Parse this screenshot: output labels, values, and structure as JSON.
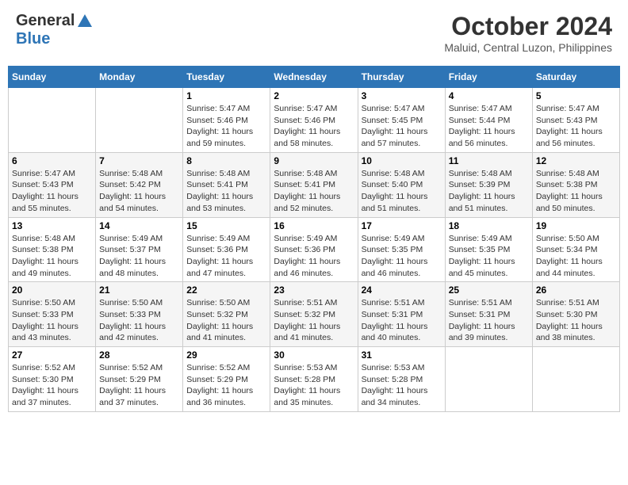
{
  "header": {
    "logo_line1": "General",
    "logo_line2": "Blue",
    "month": "October 2024",
    "location": "Maluid, Central Luzon, Philippines"
  },
  "weekdays": [
    "Sunday",
    "Monday",
    "Tuesday",
    "Wednesday",
    "Thursday",
    "Friday",
    "Saturday"
  ],
  "weeks": [
    [
      {
        "day": "",
        "sunrise": "",
        "sunset": "",
        "daylight": ""
      },
      {
        "day": "",
        "sunrise": "",
        "sunset": "",
        "daylight": ""
      },
      {
        "day": "1",
        "sunrise": "Sunrise: 5:47 AM",
        "sunset": "Sunset: 5:46 PM",
        "daylight": "Daylight: 11 hours and 59 minutes."
      },
      {
        "day": "2",
        "sunrise": "Sunrise: 5:47 AM",
        "sunset": "Sunset: 5:46 PM",
        "daylight": "Daylight: 11 hours and 58 minutes."
      },
      {
        "day": "3",
        "sunrise": "Sunrise: 5:47 AM",
        "sunset": "Sunset: 5:45 PM",
        "daylight": "Daylight: 11 hours and 57 minutes."
      },
      {
        "day": "4",
        "sunrise": "Sunrise: 5:47 AM",
        "sunset": "Sunset: 5:44 PM",
        "daylight": "Daylight: 11 hours and 56 minutes."
      },
      {
        "day": "5",
        "sunrise": "Sunrise: 5:47 AM",
        "sunset": "Sunset: 5:43 PM",
        "daylight": "Daylight: 11 hours and 56 minutes."
      }
    ],
    [
      {
        "day": "6",
        "sunrise": "Sunrise: 5:47 AM",
        "sunset": "Sunset: 5:43 PM",
        "daylight": "Daylight: 11 hours and 55 minutes."
      },
      {
        "day": "7",
        "sunrise": "Sunrise: 5:48 AM",
        "sunset": "Sunset: 5:42 PM",
        "daylight": "Daylight: 11 hours and 54 minutes."
      },
      {
        "day": "8",
        "sunrise": "Sunrise: 5:48 AM",
        "sunset": "Sunset: 5:41 PM",
        "daylight": "Daylight: 11 hours and 53 minutes."
      },
      {
        "day": "9",
        "sunrise": "Sunrise: 5:48 AM",
        "sunset": "Sunset: 5:41 PM",
        "daylight": "Daylight: 11 hours and 52 minutes."
      },
      {
        "day": "10",
        "sunrise": "Sunrise: 5:48 AM",
        "sunset": "Sunset: 5:40 PM",
        "daylight": "Daylight: 11 hours and 51 minutes."
      },
      {
        "day": "11",
        "sunrise": "Sunrise: 5:48 AM",
        "sunset": "Sunset: 5:39 PM",
        "daylight": "Daylight: 11 hours and 51 minutes."
      },
      {
        "day": "12",
        "sunrise": "Sunrise: 5:48 AM",
        "sunset": "Sunset: 5:38 PM",
        "daylight": "Daylight: 11 hours and 50 minutes."
      }
    ],
    [
      {
        "day": "13",
        "sunrise": "Sunrise: 5:48 AM",
        "sunset": "Sunset: 5:38 PM",
        "daylight": "Daylight: 11 hours and 49 minutes."
      },
      {
        "day": "14",
        "sunrise": "Sunrise: 5:49 AM",
        "sunset": "Sunset: 5:37 PM",
        "daylight": "Daylight: 11 hours and 48 minutes."
      },
      {
        "day": "15",
        "sunrise": "Sunrise: 5:49 AM",
        "sunset": "Sunset: 5:36 PM",
        "daylight": "Daylight: 11 hours and 47 minutes."
      },
      {
        "day": "16",
        "sunrise": "Sunrise: 5:49 AM",
        "sunset": "Sunset: 5:36 PM",
        "daylight": "Daylight: 11 hours and 46 minutes."
      },
      {
        "day": "17",
        "sunrise": "Sunrise: 5:49 AM",
        "sunset": "Sunset: 5:35 PM",
        "daylight": "Daylight: 11 hours and 46 minutes."
      },
      {
        "day": "18",
        "sunrise": "Sunrise: 5:49 AM",
        "sunset": "Sunset: 5:35 PM",
        "daylight": "Daylight: 11 hours and 45 minutes."
      },
      {
        "day": "19",
        "sunrise": "Sunrise: 5:50 AM",
        "sunset": "Sunset: 5:34 PM",
        "daylight": "Daylight: 11 hours and 44 minutes."
      }
    ],
    [
      {
        "day": "20",
        "sunrise": "Sunrise: 5:50 AM",
        "sunset": "Sunset: 5:33 PM",
        "daylight": "Daylight: 11 hours and 43 minutes."
      },
      {
        "day": "21",
        "sunrise": "Sunrise: 5:50 AM",
        "sunset": "Sunset: 5:33 PM",
        "daylight": "Daylight: 11 hours and 42 minutes."
      },
      {
        "day": "22",
        "sunrise": "Sunrise: 5:50 AM",
        "sunset": "Sunset: 5:32 PM",
        "daylight": "Daylight: 11 hours and 41 minutes."
      },
      {
        "day": "23",
        "sunrise": "Sunrise: 5:51 AM",
        "sunset": "Sunset: 5:32 PM",
        "daylight": "Daylight: 11 hours and 41 minutes."
      },
      {
        "day": "24",
        "sunrise": "Sunrise: 5:51 AM",
        "sunset": "Sunset: 5:31 PM",
        "daylight": "Daylight: 11 hours and 40 minutes."
      },
      {
        "day": "25",
        "sunrise": "Sunrise: 5:51 AM",
        "sunset": "Sunset: 5:31 PM",
        "daylight": "Daylight: 11 hours and 39 minutes."
      },
      {
        "day": "26",
        "sunrise": "Sunrise: 5:51 AM",
        "sunset": "Sunset: 5:30 PM",
        "daylight": "Daylight: 11 hours and 38 minutes."
      }
    ],
    [
      {
        "day": "27",
        "sunrise": "Sunrise: 5:52 AM",
        "sunset": "Sunset: 5:30 PM",
        "daylight": "Daylight: 11 hours and 37 minutes."
      },
      {
        "day": "28",
        "sunrise": "Sunrise: 5:52 AM",
        "sunset": "Sunset: 5:29 PM",
        "daylight": "Daylight: 11 hours and 37 minutes."
      },
      {
        "day": "29",
        "sunrise": "Sunrise: 5:52 AM",
        "sunset": "Sunset: 5:29 PM",
        "daylight": "Daylight: 11 hours and 36 minutes."
      },
      {
        "day": "30",
        "sunrise": "Sunrise: 5:53 AM",
        "sunset": "Sunset: 5:28 PM",
        "daylight": "Daylight: 11 hours and 35 minutes."
      },
      {
        "day": "31",
        "sunrise": "Sunrise: 5:53 AM",
        "sunset": "Sunset: 5:28 PM",
        "daylight": "Daylight: 11 hours and 34 minutes."
      },
      {
        "day": "",
        "sunrise": "",
        "sunset": "",
        "daylight": ""
      },
      {
        "day": "",
        "sunrise": "",
        "sunset": "",
        "daylight": ""
      }
    ]
  ]
}
